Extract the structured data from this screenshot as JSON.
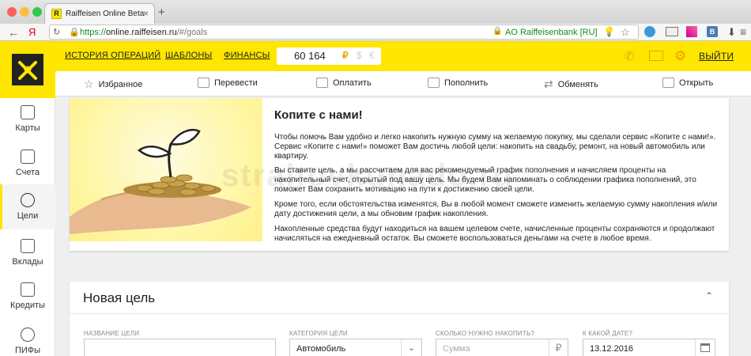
{
  "browser": {
    "tab_title": "Raiffeisen Online Beta",
    "tab_favicon": "R",
    "url_scheme": "https://",
    "url_host": "online.raiffeisen.ru",
    "url_path": "/#/goals",
    "ev_cert": "AO Raiffeisenbank [RU]",
    "yandex_label": "Я",
    "extension_label": "В"
  },
  "header": {
    "nav": [
      "ИСТОРИЯ ОПЕРАЦИЙ",
      "ШАБЛОНЫ",
      "ФИНАНСЫ"
    ],
    "balance": "60 164",
    "currencies": [
      "₽",
      "$",
      "€"
    ],
    "logout": "ВЫЙТИ",
    "accent": "#fee600"
  },
  "subnav": [
    "Избранное",
    "Перевести",
    "Оплатить",
    "Пополнить",
    "Обменять",
    "Открыть"
  ],
  "sidebar": [
    "Карты",
    "Счета",
    "Цели",
    "Вклады",
    "Кредиты",
    "ПИФы"
  ],
  "promo": {
    "title": "Копите с нами!",
    "p1": "Чтобы помочь Вам удобно и легко накопить нужную сумму на желаемую покупку, мы сделали сервис «Копите с нами!». Сервис «Копите с нами!» поможет Вам достичь любой цели: накопить на свадьбу, ремонт, на новый автомобиль или квартиру.",
    "p2": "Вы ставите цель, а мы рассчитаем для вас рекомендуемый график пополнения и начисляем проценты на накопительный счет, открытый под вашу цель. Мы будем Вам напоминать о соблюдении графика пополнений, это поможет Вам сохранить мотивацию на пути к достижению своей цели.",
    "p3": "Кроме того, если обстоятельства изменятся, Вы в любой момент сможете изменить желаемую сумму накопления и/или дату достижения цели, а мы обновим график накопления.",
    "p4": "Накопленные средства будут находиться на вашем целевом счете, начисленные проценты сохраняются и продолжают начисляться на ежедневный остаток. Вы сможете воспользоваться деньгами на счете в любое время."
  },
  "new_goal": {
    "title": "Новая цель",
    "fields": {
      "name_label": "НАЗВАНИЕ ЦЕЛИ",
      "name_value": "",
      "category_label": "КАТЕГОРИЯ ЦЕЛИ",
      "category_value": "Автомобиль",
      "amount_label": "СКОЛЬКО НУЖНО НАКОПИТЬ?",
      "amount_placeholder": "Сумма",
      "date_label": "К КАКОЙ ДАТЕ?",
      "date_value": "13.12.2016"
    }
  },
  "watermark": "strahovkunado.ru"
}
